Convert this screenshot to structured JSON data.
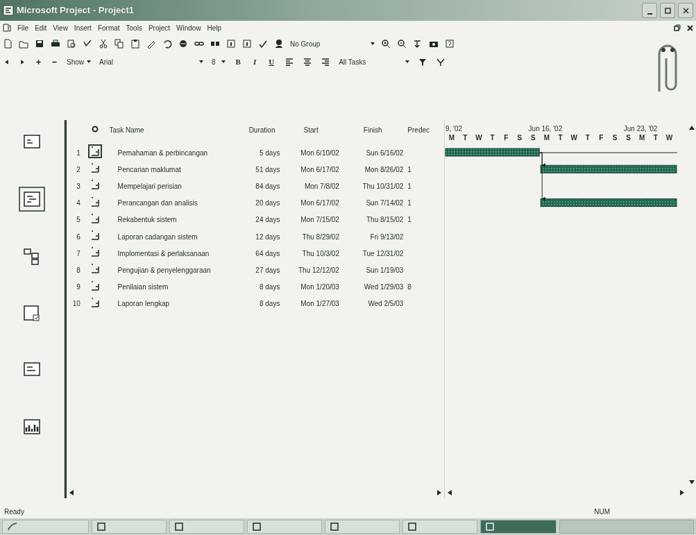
{
  "window": {
    "title": "Microsoft Project - Project1"
  },
  "menu": [
    {
      "label": "File"
    },
    {
      "label": "Edit"
    },
    {
      "label": "View"
    },
    {
      "label": "Insert"
    },
    {
      "label": "Format"
    },
    {
      "label": "Tools"
    },
    {
      "label": "Project"
    },
    {
      "label": "Window"
    },
    {
      "label": "Help"
    }
  ],
  "standard_toolbar": {
    "group_box": "No Group"
  },
  "formatting_toolbar": {
    "show": "Show",
    "font": "Arial",
    "size": "8",
    "bold": "B",
    "italic": "I",
    "underline": "U",
    "filter": "All Tasks"
  },
  "views": [
    {
      "kind": "calendar",
      "selected": false
    },
    {
      "kind": "gantt",
      "selected": true
    },
    {
      "kind": "network",
      "selected": false
    },
    {
      "kind": "usage",
      "selected": false
    },
    {
      "kind": "tracking",
      "selected": false
    },
    {
      "kind": "graph",
      "selected": false
    }
  ],
  "table": {
    "columns": [
      "Task Name",
      "Duration",
      "Start",
      "Finish",
      "Predec"
    ],
    "rows": [
      {
        "id": "1",
        "name": "Pemahaman & perbincangan",
        "duration": "5 days",
        "start": "Mon 6/10/02",
        "finish": "Sun 6/16/02",
        "predecessors": "",
        "selected": true
      },
      {
        "id": "2",
        "name": "Pencarian maklumat",
        "duration": "51 days",
        "start": "Mon 6/17/02",
        "finish": "Mon 8/26/02",
        "predecessors": "1",
        "selected": false
      },
      {
        "id": "3",
        "name": "Mempelajari perisian",
        "duration": "84 days",
        "start": "Mon 7/8/02",
        "finish": "Thu 10/31/02",
        "predecessors": "1",
        "selected": false
      },
      {
        "id": "4",
        "name": "Perancangan dan analisis",
        "duration": "20 days",
        "start": "Mon 6/17/02",
        "finish": "Sun 7/14/02",
        "predecessors": "1",
        "selected": false
      },
      {
        "id": "5",
        "name": "Rekabentuk sistem",
        "duration": "24 days",
        "start": "Mon 7/15/02",
        "finish": "Thu 8/15/02",
        "predecessors": "1",
        "selected": false
      },
      {
        "id": "6",
        "name": "Laporan cadangan sistem",
        "duration": "12 days",
        "start": "Thu 8/29/02",
        "finish": "Fri 9/13/02",
        "predecessors": "",
        "selected": false
      },
      {
        "id": "7",
        "name": "Implomentasi & perlaksanaan",
        "duration": "64 days",
        "start": "Thu 10/3/02",
        "finish": "Tue 12/31/02",
        "predecessors": "",
        "selected": false
      },
      {
        "id": "8",
        "name": "Pengujian & penyelenggaraan",
        "duration": "27 days",
        "start": "Thu 12/12/02",
        "finish": "Sun 1/19/03",
        "predecessors": "",
        "selected": false
      },
      {
        "id": "9",
        "name": "Penilaian sistem",
        "duration": "8 days",
        "start": "Mon 1/20/03",
        "finish": "Wed 1/29/03",
        "predecessors": "8",
        "selected": false
      },
      {
        "id": "10",
        "name": "Laporan lengkap",
        "duration": "8 days",
        "start": "Mon 1/27/03",
        "finish": "Wed 2/5/03",
        "predecessors": "",
        "selected": false
      }
    ]
  },
  "gantt": {
    "weeks": [
      {
        "label": "9, '02"
      },
      {
        "label": "Jun 16, '02"
      },
      {
        "label": "Jun 23, '02"
      }
    ],
    "days": [
      "M",
      "T",
      "W",
      "T",
      "F",
      "S",
      "S",
      "M",
      "T",
      "W",
      "T",
      "F",
      "S",
      "S",
      "M",
      "T",
      "W"
    ]
  },
  "status_bar": {
    "left": "Ready",
    "indicator": "NUM"
  }
}
